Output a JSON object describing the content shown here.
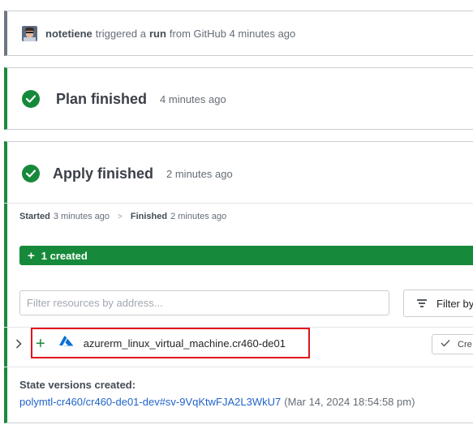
{
  "trigger": {
    "user": "notetiene",
    "text1": "triggered a",
    "run_word": "run",
    "text2": "from GitHub 4 minutes ago"
  },
  "plan": {
    "title": "Plan finished",
    "time": "4 minutes ago"
  },
  "apply": {
    "title": "Apply finished",
    "time": "2 minutes ago",
    "started_label": "Started",
    "started_time": "3 minutes ago",
    "separator": ">",
    "finished_label": "Finished",
    "finished_time": "2 minutes ago",
    "created_banner": "1 created",
    "filter_placeholder": "Filter resources by address...",
    "filter_button": "Filter by",
    "resource": {
      "name": "azurerm_linux_virtual_machine.cr460-de01",
      "action_symbol": "+",
      "button": "Cre"
    },
    "state_versions_label": "State versions created:",
    "state_link": "polymtl-cr460/cr460-de01-dev#sv-9VqKtwFJA2L3WkU7",
    "state_date": "(Mar 14, 2024 18:54:58 pm)"
  },
  "colors": {
    "success_green": "#168a3a",
    "highlight_red": "#e0141e",
    "link_blue": "#1f63c9",
    "azure_blue": "#0a6fd6"
  }
}
